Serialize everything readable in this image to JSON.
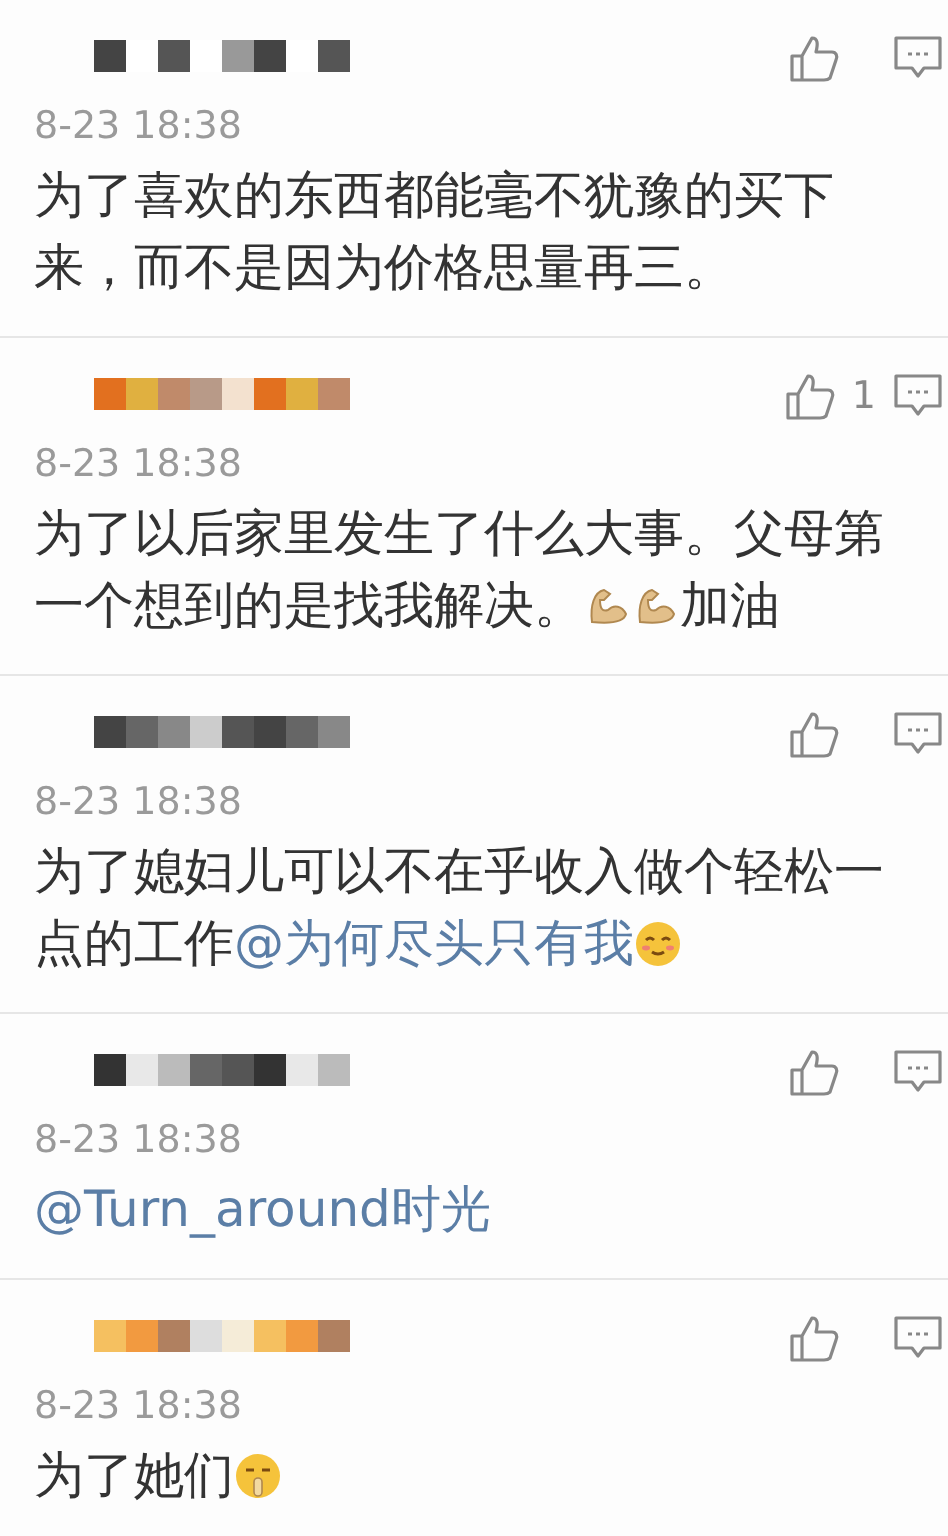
{
  "comments": [
    {
      "time": "8-23 18:38",
      "parts": [
        {
          "kind": "text",
          "text": "为了喜欢的东西都能毫不犹豫的买下来，而不是因为价格思量再三。"
        }
      ]
    },
    {
      "time": "8-23 18:38",
      "likes": "1",
      "parts": [
        {
          "kind": "text",
          "text": "为了以后家里发生了什么大事。父母第一个想到的是找我解决。"
        },
        {
          "kind": "muscle"
        },
        {
          "kind": "muscle"
        },
        {
          "kind": "text",
          "text": "加油"
        }
      ]
    },
    {
      "time": "8-23 18:38",
      "parts": [
        {
          "kind": "text",
          "text": "为了媳妇儿可以不在乎收入做个轻松一点的工作"
        },
        {
          "kind": "mention",
          "text": "@为何尽头只有我"
        },
        {
          "kind": "smile"
        }
      ]
    },
    {
      "time": "8-23 18:38",
      "parts": [
        {
          "kind": "mention",
          "text": "@Turn_around时光"
        }
      ]
    },
    {
      "time": "8-23 18:38",
      "parts": [
        {
          "kind": "text",
          "text": "为了她们"
        },
        {
          "kind": "shush"
        }
      ]
    }
  ]
}
